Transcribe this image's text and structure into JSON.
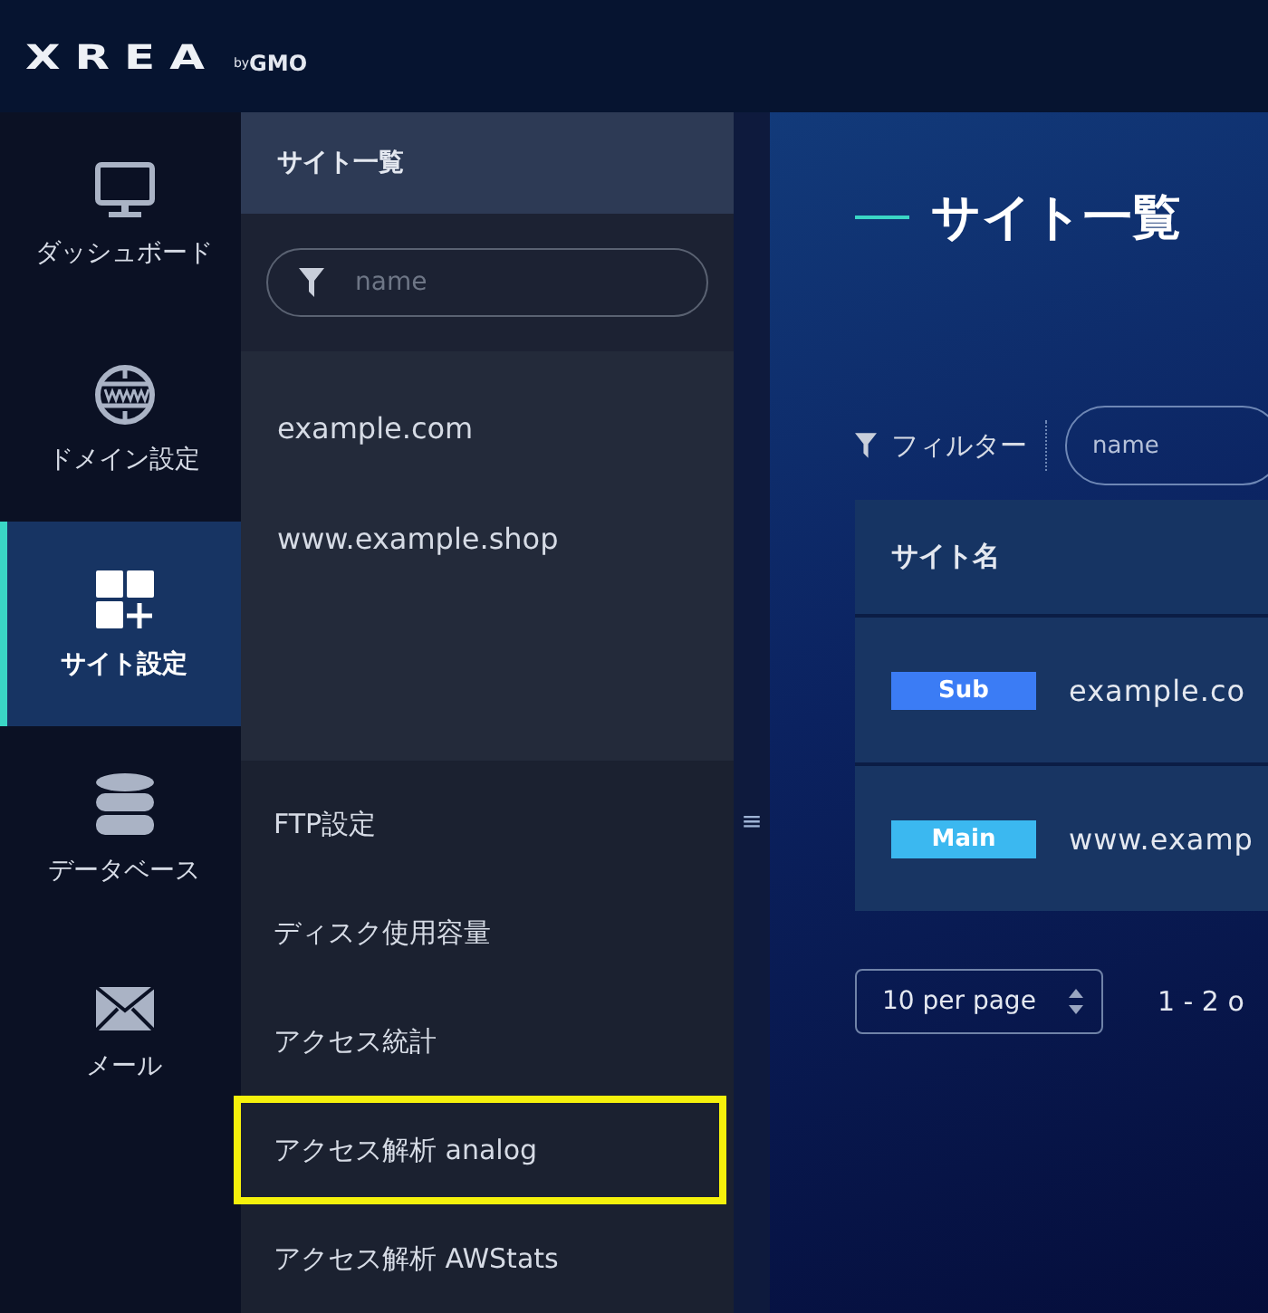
{
  "header": {
    "logo": "XREA",
    "logo_suffix_small": "by",
    "logo_suffix": "GMO"
  },
  "nav": [
    {
      "label": "ダッシュボード",
      "selected": false
    },
    {
      "label": "ドメイン設定",
      "selected": false
    },
    {
      "label": "サイト設定",
      "selected": true
    },
    {
      "label": "データベース",
      "selected": false
    },
    {
      "label": "メール",
      "selected": false
    }
  ],
  "site_panel": {
    "title": "サイト一覧",
    "search": {
      "placeholder": "name"
    },
    "sites": [
      "example.com",
      "www.example.shop"
    ],
    "menu": [
      {
        "label": "FTP設定",
        "highlighted": false
      },
      {
        "label": "ディスク使用容量",
        "highlighted": false
      },
      {
        "label": "アクセス統計",
        "highlighted": false
      },
      {
        "label": "アクセス解析 analog",
        "highlighted": true
      },
      {
        "label": "アクセス解析 AWStats",
        "highlighted": false
      }
    ],
    "collapse_handle": "≡"
  },
  "main": {
    "title": "サイト一覧",
    "filter_label": "フィルター",
    "filter": {
      "placeholder": "name"
    },
    "table": {
      "columns": [
        "サイト名"
      ],
      "rows": [
        {
          "badge": "Sub",
          "color": "#3b7cf5",
          "name": "example.co"
        },
        {
          "badge": "Main",
          "color": "#3bb8f0",
          "name": "www.examp"
        }
      ]
    },
    "per_page": "10 per page",
    "range": "1 - 2 o"
  }
}
